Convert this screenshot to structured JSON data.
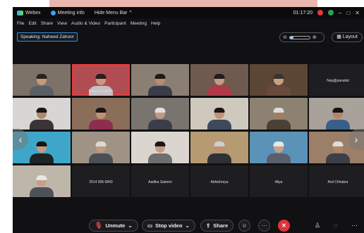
{
  "app": {
    "name": "Webex",
    "meeting_info": "Meeting info",
    "hide_menu_bar": "Hide Menu Bar",
    "timer": "01:17:20"
  },
  "menu": [
    "File",
    "Edit",
    "Share",
    "View",
    "Audio & Video",
    "Participant",
    "Meeting",
    "Help"
  ],
  "speaking_label": "Speaking: Naheed Zahoor",
  "zoom": {
    "level": 0.2
  },
  "layout_label": "Layout",
  "participants": [
    {
      "name": "",
      "bg": "#7d7268",
      "skin": "#c59a7e",
      "shirt": "#5a5f66",
      "hair": "#2a2420"
    },
    {
      "name": "Naheed Zahoor",
      "bg": "#b14d52",
      "skin": "#c99a82",
      "shirt": "#c7bfc2",
      "hair": "#2a1e1e",
      "active": true
    },
    {
      "name": "",
      "bg": "#8a7f72",
      "skin": "#b98a74",
      "shirt": "#3a3c48",
      "hair": "#1e1a18"
    },
    {
      "name": "",
      "bg": "#6f5a4f",
      "skin": "#c79a86",
      "shirt": "#b03a4a",
      "hair": "#241c18"
    },
    {
      "name": "",
      "bg": "#5c4636",
      "skin": "#c9a086",
      "shirt": "#6a4a3c",
      "hair": "#3b3430"
    },
    {
      "name": "Nep@panalist",
      "blank": true
    },
    {
      "name": "",
      "bg": "#d8d6d4",
      "skin": "#b3876d",
      "shirt": "#3a3436",
      "hair": "#1c1818"
    },
    {
      "name": "",
      "bg": "#8b6e5a",
      "skin": "#c39073",
      "shirt": "#8e2e4e",
      "hair": "#1e1614"
    },
    {
      "name": "",
      "bg": "#7a746e",
      "skin": "#c29a84",
      "shirt": "#3b3d4a",
      "hair": "#e0e0e0"
    },
    {
      "name": "",
      "bg": "#cfc8bd",
      "skin": "#c49274",
      "shirt": "#3e4a5c",
      "hair": "#1c1616"
    },
    {
      "name": "",
      "bg": "#8d8272",
      "skin": "#a97a62",
      "shirt": "#4a4036",
      "hair": "#dcdcdc"
    },
    {
      "name": "",
      "bg": "#a8a29a",
      "skin": "#b58467",
      "shirt": "#3a5e8a",
      "hair": "#161212"
    },
    {
      "name": "",
      "bg": "#3ea7c9",
      "skin": "#c8977c",
      "shirt": "#202226",
      "hair": "#181412"
    },
    {
      "name": "",
      "bg": "#a09386",
      "skin": "#c59a80",
      "shirt": "#4b4f56",
      "hair": "#dadada"
    },
    {
      "name": "",
      "bg": "#dad6cf",
      "skin": "#c69a84",
      "shirt": "#6e6e70",
      "hair": "#1a1616"
    },
    {
      "name": "",
      "bg": "#b59a72",
      "skin": "#c09074",
      "shirt": "#2f3136",
      "hair": "#cfcfcf"
    },
    {
      "name": "",
      "bg": "#5b92b8",
      "skin": "#c9a08a",
      "shirt": "#5a5f6a",
      "hair": "#e6e6e6"
    },
    {
      "name": "",
      "bg": "#9c7f69",
      "skin": "#b38468",
      "shirt": "#3c3f46",
      "hair": "#dddddd"
    },
    {
      "name": "",
      "bg": "#bfb6aa",
      "skin": "#c99e88",
      "shirt": "#4e5258",
      "hair": "#e6e6e6"
    },
    {
      "name": "2514 906 6843",
      "blank": true
    },
    {
      "name": "Aadika Saleem",
      "blank": true
    },
    {
      "name": "Abhishreya",
      "blank": true
    },
    {
      "name": "Aliya",
      "blank": true
    },
    {
      "name": "Anil Chhabra",
      "blank": true
    }
  ],
  "controls": {
    "mute": "Unmute",
    "video": "Stop video",
    "share": "Share"
  },
  "colors": {
    "accent": "#3a8fd6",
    "end": "#e0343a",
    "active_border": "#e83a3a"
  }
}
